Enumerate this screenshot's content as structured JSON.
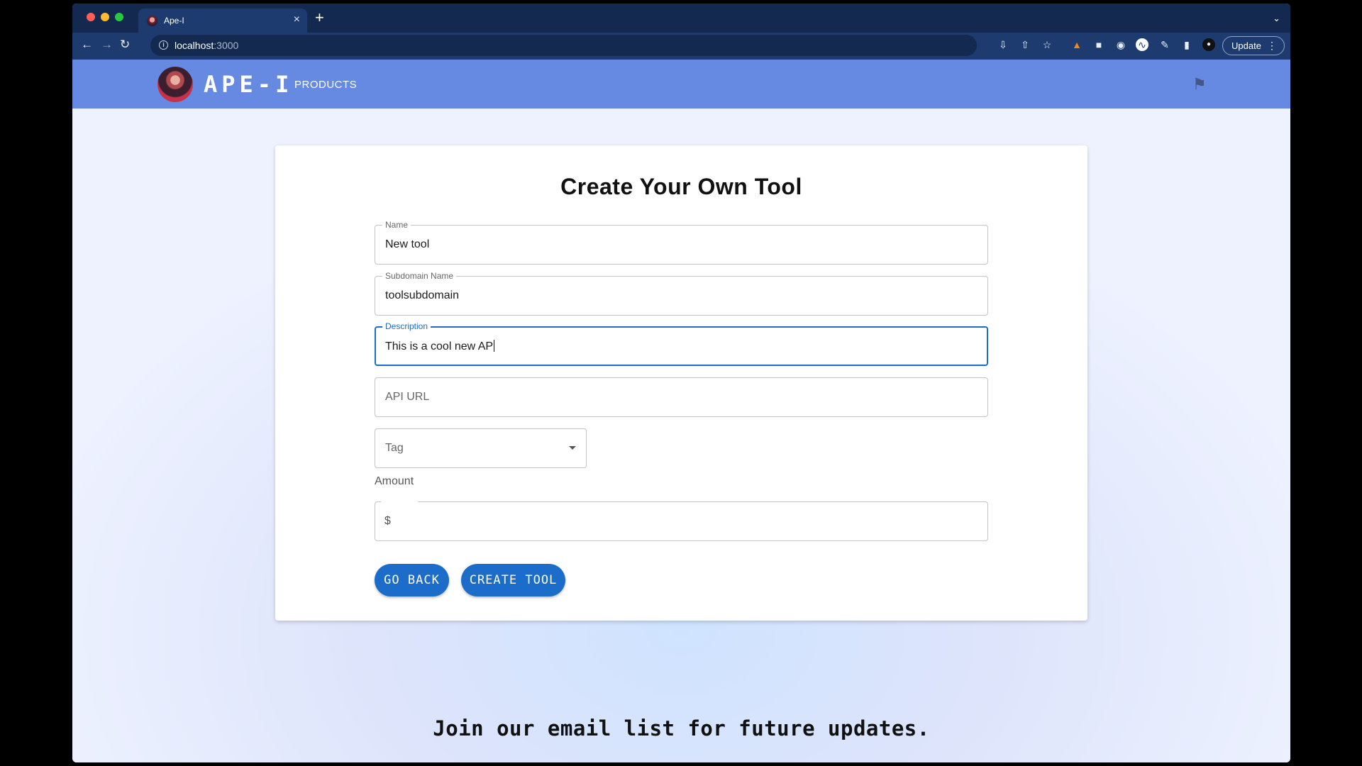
{
  "browser": {
    "tab_title": "Ape-I",
    "tab_close": "×",
    "new_tab": "+",
    "url_host": "localhost",
    "url_port": ":3000",
    "update_label": "Update"
  },
  "header": {
    "brand": "APE-I",
    "nav": [
      {
        "label": "PRODUCTS"
      }
    ]
  },
  "form": {
    "title": "Create Your Own Tool",
    "name": {
      "label": "Name",
      "value": "New tool"
    },
    "subdomain": {
      "label": "Subdomain Name",
      "value": "toolsubdomain"
    },
    "description": {
      "label": "Description",
      "value": "This is a cool new AP"
    },
    "api_url": {
      "placeholder": "API URL"
    },
    "tag": {
      "placeholder": "Tag"
    },
    "amount": {
      "label": "Amount",
      "prefix": "$"
    },
    "buttons": {
      "back": "GO BACK",
      "create": "CREATE TOOL"
    }
  },
  "footer": {
    "join_text": "Join our email list for future updates."
  },
  "colors": {
    "appbar": "#6689e1",
    "primary": "#1c6dc9",
    "chrome": "#1d3b6e"
  }
}
